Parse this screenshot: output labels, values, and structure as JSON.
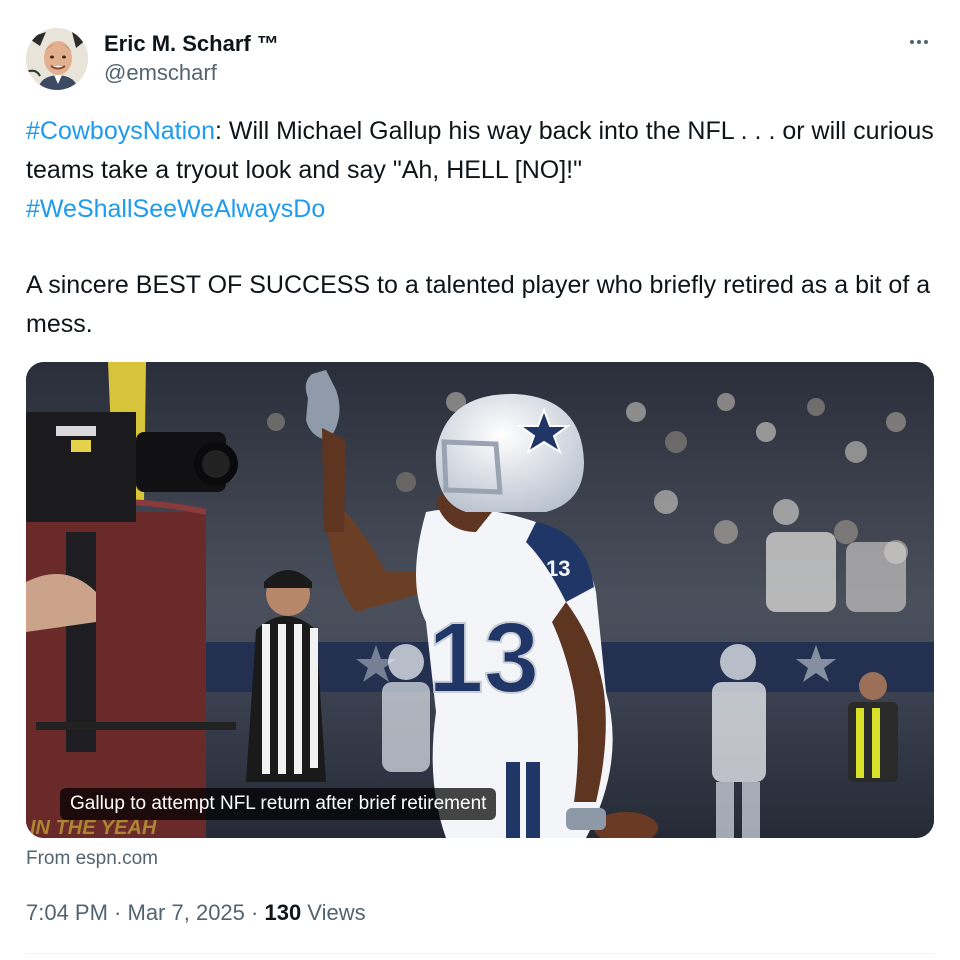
{
  "author": {
    "display_name": "Eric M. Scharf ™",
    "handle": "@emscharf"
  },
  "tweet": {
    "hashtag_1": "#CowboysNation",
    "line_1_rest": ": Will Michael Gallup his way back into the NFL . . . or will curious teams take a tryout look and say \"Ah, HELL [NO]!\"",
    "hashtag_2": "#WeShallSeeWeAlwaysDo",
    "paragraph_2": "A sincere BEST OF SUCCESS to a talented player who briefly retired as a bit of a mess."
  },
  "media": {
    "caption": "Gallup to attempt NFL return after brief retirement",
    "jersey_number": "13",
    "sleeve_number": "13",
    "source": "From espn.com"
  },
  "meta": {
    "time": "7:04 PM",
    "separator_1": " · ",
    "date": "Mar 7, 2025",
    "separator_2": " · ",
    "views_count": "130",
    "views_label": " Views"
  },
  "icons": {
    "more": "more-horizontal-icon"
  },
  "colors": {
    "link_blue": "#1d9bf0",
    "secondary_text": "#536471",
    "primary_text": "#0f1419",
    "cowboys_navy": "#0c2a5b"
  }
}
